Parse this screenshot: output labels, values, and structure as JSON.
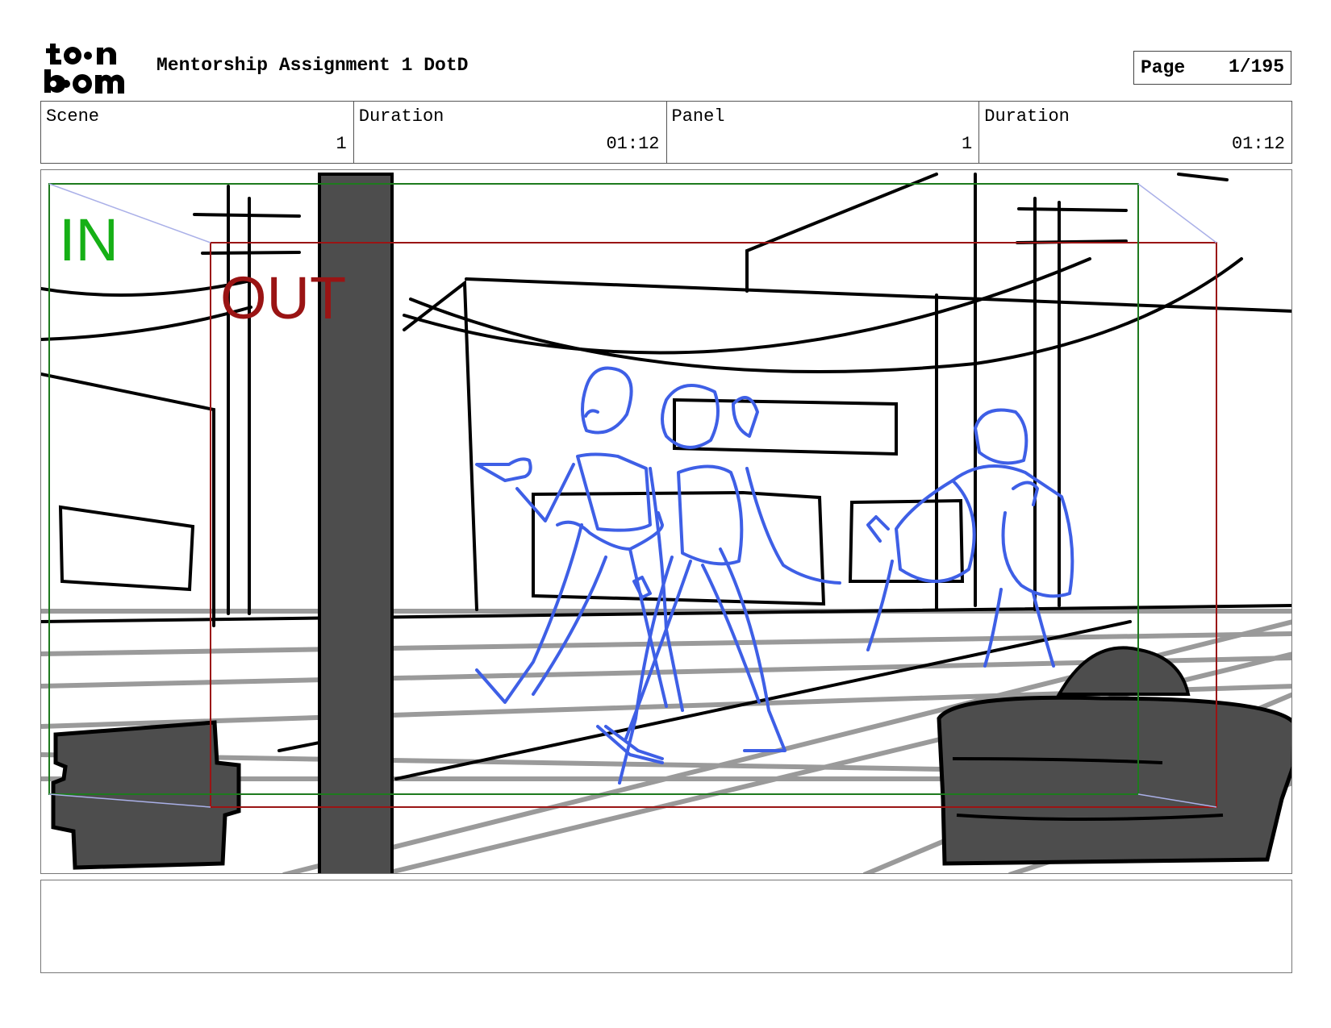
{
  "header": {
    "logo_text": "toon boom",
    "project_title": "Mentorship Assignment 1 DotD",
    "page_label": "Page",
    "page_value": "1/195"
  },
  "info": [
    {
      "label": "Scene",
      "value": "1"
    },
    {
      "label": "Duration",
      "value": "01:12"
    },
    {
      "label": "Panel",
      "value": "1"
    },
    {
      "label": "Duration",
      "value": "01:12"
    }
  ],
  "panel": {
    "in_label": "IN",
    "out_label": "OUT",
    "colors": {
      "in_frame": "#1e7a1e",
      "in_text": "#16b016",
      "out_frame": "#9a1414",
      "sketch": "#3e5fe6",
      "dark_fill": "#4d4d4d"
    }
  },
  "notes": {
    "text": ""
  }
}
